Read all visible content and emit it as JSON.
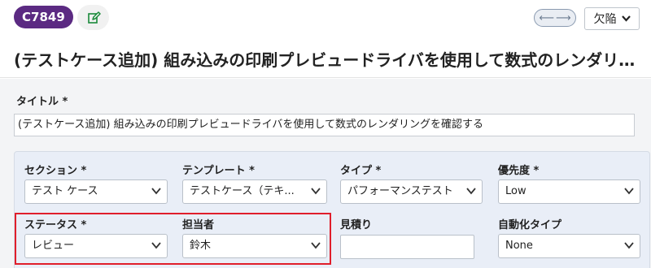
{
  "header": {
    "case_id": "C7849",
    "type_label": "欠陥",
    "title": "(テストケース追加) 組み込みの印刷プレビュードライバを使用して数式のレンダリングを確..."
  },
  "icons": {
    "edit": "pencil-edit-icon",
    "nav_prev": "arrow-left-icon",
    "nav_next": "arrow-right-icon",
    "dropdown": "chevron-down-icon"
  },
  "colors": {
    "badge": "#5b2a82",
    "edit_icon": "#1a8a3a",
    "highlight": "#e01e2b"
  },
  "form": {
    "title_label": "タイトル *",
    "title_value": "(テストケース追加) 組み込みの印刷プレビュードライバを使用して数式のレンダリングを確認する",
    "section": {
      "label": "セクション *",
      "value": "テスト ケース"
    },
    "template": {
      "label": "テンプレート *",
      "value": "テストケース（テキ..."
    },
    "type": {
      "label": "タイプ *",
      "value": "パフォーマンステスト"
    },
    "priority": {
      "label": "優先度 *",
      "value": "Low"
    },
    "status": {
      "label": "ステータス *",
      "value": "レビュー"
    },
    "assignee": {
      "label": "担当者",
      "value": "鈴木"
    },
    "estimate": {
      "label": "見積り",
      "value": ""
    },
    "automation": {
      "label": "自動化タイプ",
      "value": "None"
    }
  }
}
